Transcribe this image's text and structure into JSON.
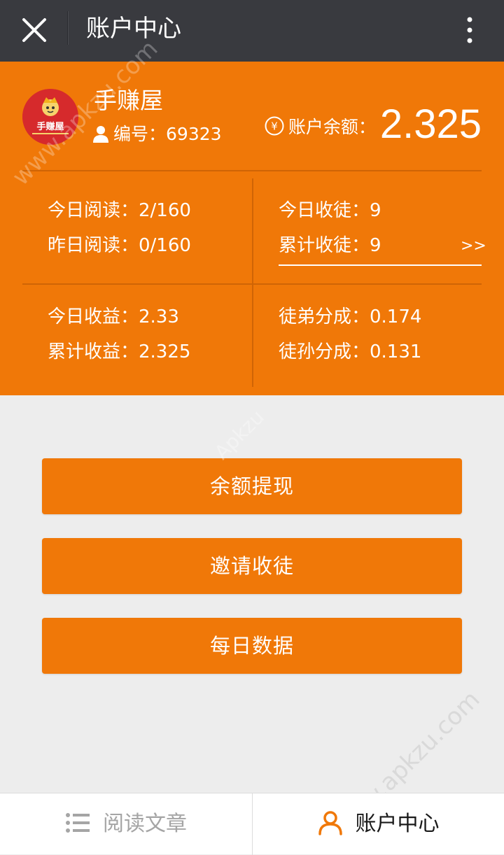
{
  "topbar": {
    "title": "账户中心"
  },
  "profile": {
    "app_name": "手赚屋",
    "avatar_logo_text": "手赚屋",
    "user_id_label": "编号：",
    "user_id": "69323",
    "balance_label": "账户余额：",
    "balance": "2.325"
  },
  "stats": {
    "today_read": "今日阅读：2/160",
    "yesterday_read": "昨日阅读：0/160",
    "today_recruit": "今日收徒：9",
    "total_recruit": "累计收徒：9",
    "more_link": ">>",
    "today_income": "今日收益：2.33",
    "total_income": "累计收益：2.325",
    "apprentice_share": "徒弟分成：0.174",
    "grand_apprentice_share": "徒孙分成：0.131"
  },
  "actions": {
    "withdraw": "余额提现",
    "invite": "邀请收徒",
    "daily_data": "每日数据"
  },
  "tabbar": {
    "read_articles": "阅读文章",
    "account_center": "账户中心"
  },
  "watermark": {
    "text": "www.apkzu.com",
    "text_short": "Apkzu"
  },
  "colors": {
    "brand_orange": "#f07808",
    "topbar_dark": "#393a3f",
    "background": "#ededed",
    "tab_active_icon": "#f07808"
  }
}
